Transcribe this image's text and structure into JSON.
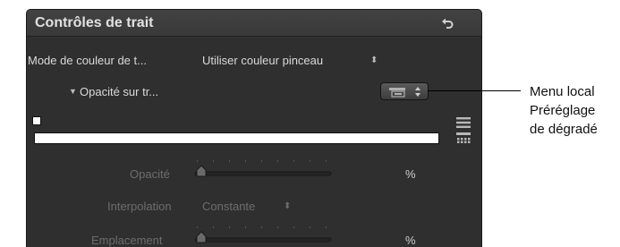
{
  "panel": {
    "title": "Contrôles de trait",
    "color_mode_label": "Mode de couleur de t...",
    "color_mode_value": "Utiliser couleur pinceau",
    "opacity_group_label": "Opacité sur tr...",
    "opacity_label": "Opacité",
    "opacity_unit": "%",
    "interpolation_label": "Interpolation",
    "interpolation_value": "Constante",
    "location_label": "Emplacement",
    "location_unit": "%"
  },
  "callout": {
    "line1": "Menu local",
    "line2": "Préréglage",
    "line3": "de dégradé"
  },
  "icons": {
    "reset": "reset-arrow-icon",
    "disclosure": "triangle-down-icon",
    "stepper": "up-down-arrows-icon",
    "preset": "gradient-preset-icon",
    "list": "list-icon",
    "grid": "grid-icon"
  },
  "colors": {
    "panel_bg": "#2f2f2f",
    "header_bg": "#3f3f3f",
    "text": "#d9d9d9",
    "dim_text": "#6d6d6d",
    "gradient": "#ffffff"
  }
}
